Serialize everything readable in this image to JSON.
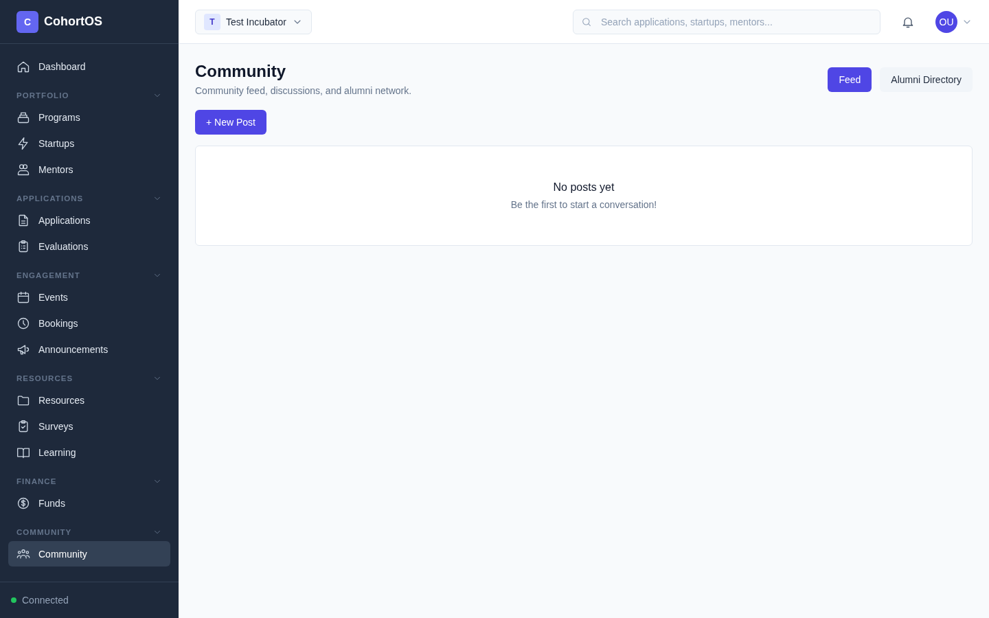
{
  "brand": {
    "logo_letter": "C",
    "name": "CohortOS"
  },
  "sidebar": {
    "top_items": [
      {
        "label": "Dashboard",
        "selected": false
      }
    ],
    "sections": [
      {
        "title": "PORTFOLIO",
        "expanded": true,
        "items": [
          {
            "label": "Programs",
            "selected": false
          },
          {
            "label": "Startups",
            "selected": false
          },
          {
            "label": "Mentors",
            "selected": false
          }
        ]
      },
      {
        "title": "APPLICATIONS",
        "expanded": true,
        "items": [
          {
            "label": "Applications",
            "selected": false
          },
          {
            "label": "Evaluations",
            "selected": false
          }
        ]
      },
      {
        "title": "ENGAGEMENT",
        "expanded": true,
        "items": [
          {
            "label": "Events",
            "selected": false
          },
          {
            "label": "Bookings",
            "selected": false
          },
          {
            "label": "Announcements",
            "selected": false
          }
        ]
      },
      {
        "title": "RESOURCES",
        "expanded": true,
        "items": [
          {
            "label": "Resources",
            "selected": false
          },
          {
            "label": "Surveys",
            "selected": false
          },
          {
            "label": "Learning",
            "selected": false
          }
        ]
      },
      {
        "title": "FINANCE",
        "expanded": true,
        "items": [
          {
            "label": "Funds",
            "selected": false
          }
        ]
      },
      {
        "title": "COMMUNITY",
        "expanded": true,
        "items": [
          {
            "label": "Community",
            "selected": true
          }
        ]
      }
    ],
    "status": {
      "label": "Connected",
      "online": true
    }
  },
  "topbar": {
    "workspace": {
      "initial": "T",
      "name": "Test Incubator"
    },
    "search": {
      "placeholder": "Search applications, startups, mentors..."
    },
    "user": {
      "initials": "OU"
    }
  },
  "page": {
    "title": "Community",
    "subtitle": "Community feed, discussions, and alumni network.",
    "tabs": [
      {
        "label": "Feed",
        "selected": true
      },
      {
        "label": "Alumni Directory",
        "selected": false
      }
    ],
    "new_post_button": "+ New Post",
    "empty_state": {
      "title": "No posts yet",
      "message": "Be the first to start a conversation!"
    }
  }
}
